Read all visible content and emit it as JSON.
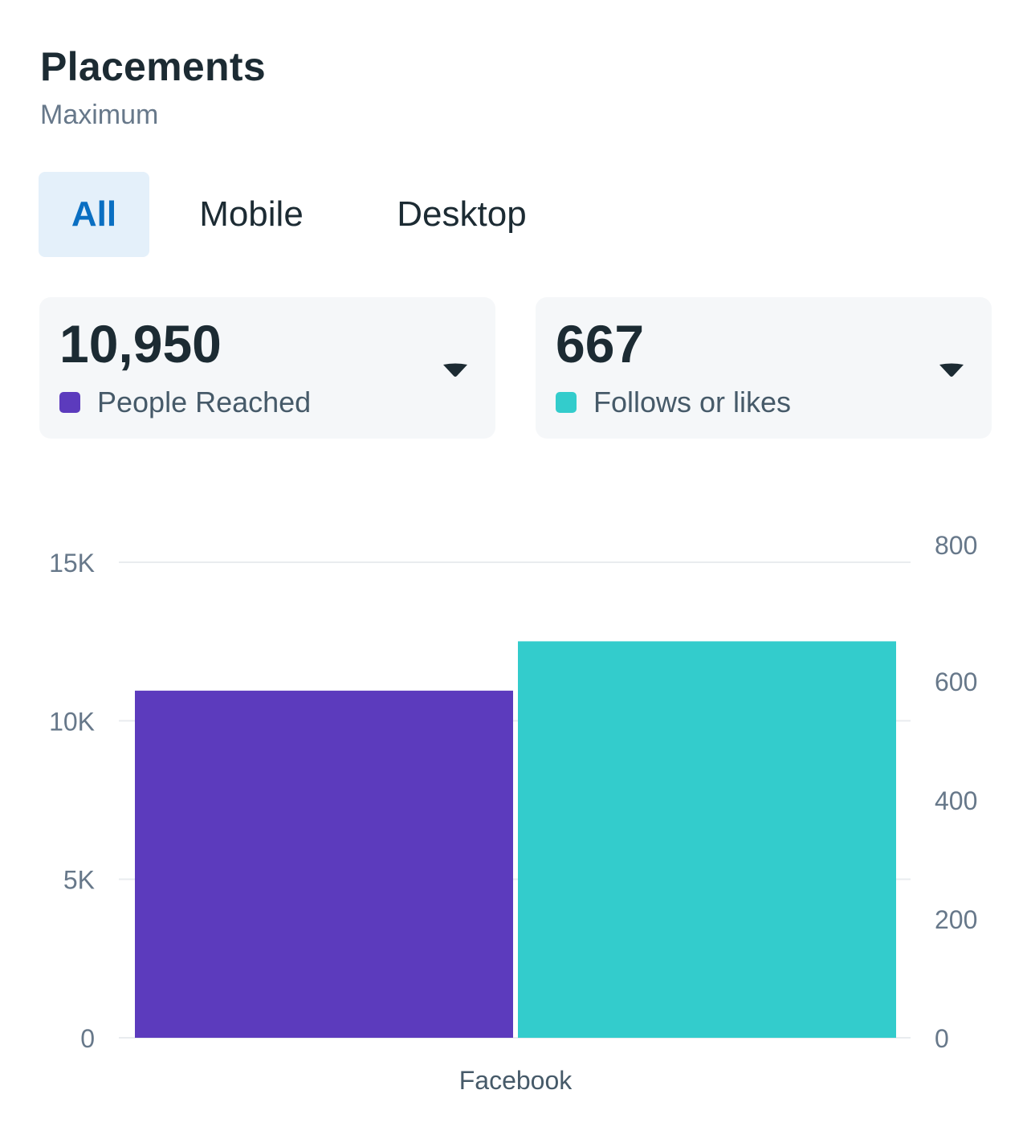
{
  "header": {
    "title": "Placements",
    "subtitle": "Maximum"
  },
  "tabs": [
    {
      "label": "All",
      "active": true
    },
    {
      "label": "Mobile",
      "active": false
    },
    {
      "label": "Desktop",
      "active": false
    }
  ],
  "metrics": [
    {
      "value": "10,950",
      "label": "People Reached",
      "color": "#5c3bbd",
      "icon": "chevron-down-icon"
    },
    {
      "value": "667",
      "label": "Follows or likes",
      "color": "#33cccc",
      "icon": "chevron-down-icon"
    }
  ],
  "colors": {
    "tab_active_bg": "#e4f0fa",
    "tab_active_text": "#0a6fc2",
    "card_bg": "#f5f7f9",
    "gridline": "#e9ecef",
    "axis_text": "#67788a"
  },
  "chart_data": {
    "type": "bar",
    "categories": [
      "Facebook"
    ],
    "series": [
      {
        "name": "People Reached",
        "values": [
          10950
        ],
        "axis": "left",
        "color": "#5c3bbd"
      },
      {
        "name": "Follows or likes",
        "values": [
          667
        ],
        "axis": "right",
        "color": "#33cccc"
      }
    ],
    "y_left": {
      "ticks": [
        0,
        5000,
        10000,
        15000
      ],
      "tick_labels": [
        "0",
        "5K",
        "10K",
        "15K"
      ],
      "range": [
        0,
        15000
      ]
    },
    "y_right": {
      "ticks": [
        0,
        200,
        400,
        600,
        800
      ],
      "tick_labels": [
        "0",
        "200",
        "400",
        "600",
        "800"
      ],
      "range": [
        0,
        800
      ]
    },
    "grid": true,
    "legend": "none",
    "title": "",
    "xlabel": "",
    "ylabel": ""
  }
}
